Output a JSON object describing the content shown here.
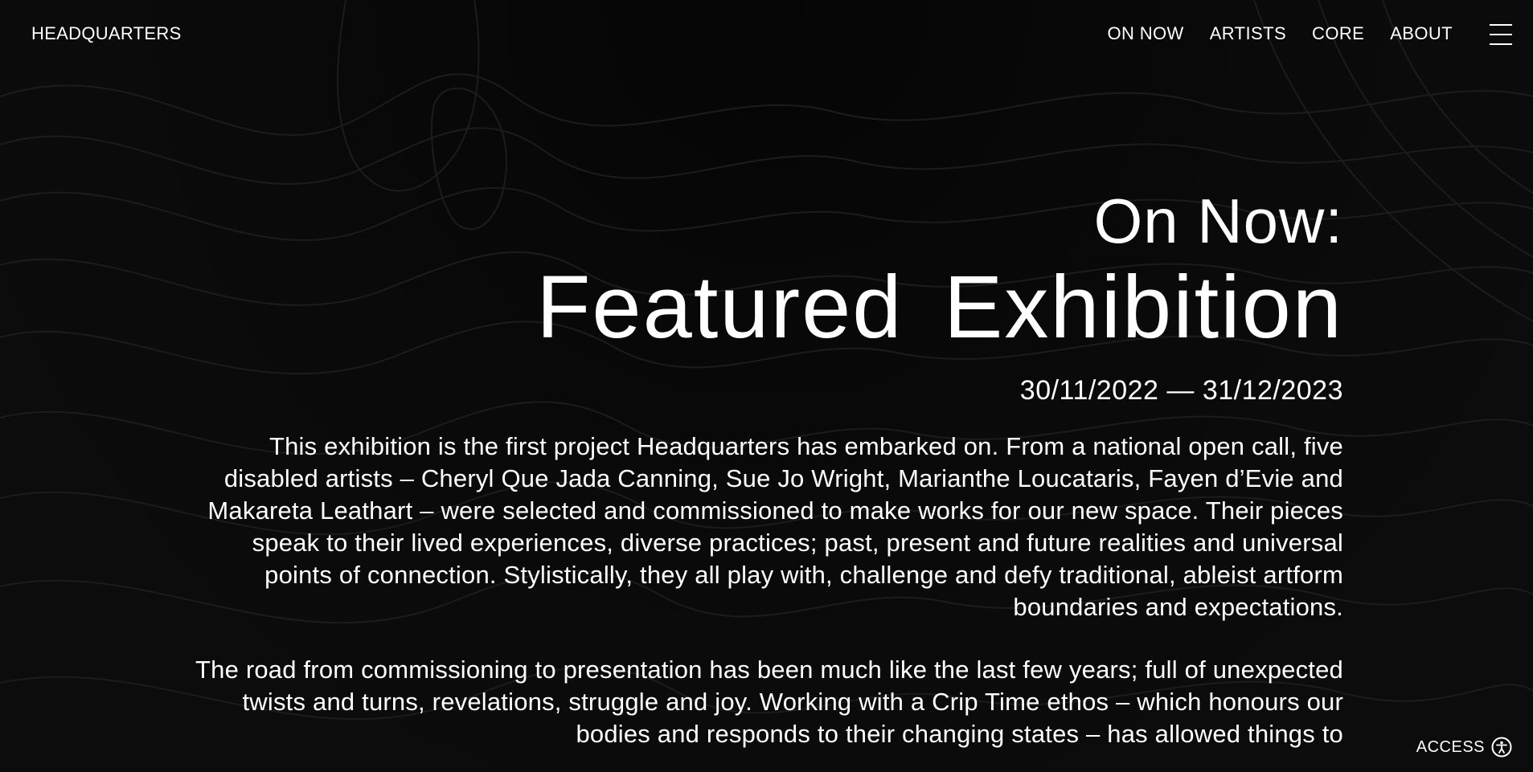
{
  "header": {
    "logo": "HEADQUARTERS",
    "nav": [
      {
        "label": "ON NOW"
      },
      {
        "label": "ARTISTS"
      },
      {
        "label": "CORE"
      },
      {
        "label": "ABOUT"
      }
    ],
    "menu_icon": "hamburger-menu-icon"
  },
  "hero": {
    "eyebrow": "On Now:",
    "title": "Featured Exhibition",
    "dates": "30/11/2022 — 31/12/2023",
    "paragraphs": [
      "This exhibition is the first project Headquarters has embarked on. From a national open call, five disabled artists – Cheryl Que Jada Canning, Sue Jo Wright, Marianthe Loucataris, Fayen d’Evie and Makareta Leathart – were selected and commissioned to make works for our new space. Their pieces speak to their lived experiences, diverse practices; past, present and future realities and universal points of connection. Stylistically, they all play with, challenge and defy traditional, ableist artform boundaries and expectations.",
      "The road from commissioning to presentation has been much like the last few years; full of unexpected twists and turns, revelations, struggle and joy. Working with a Crip Time ethos – which honours our bodies and responds to their changing states – has allowed things to"
    ]
  },
  "access": {
    "label": "ACCESS",
    "icon": "accessibility-icon"
  },
  "colors": {
    "background": "#0a0a0a",
    "text": "#ffffff",
    "contour": "#1c1c1c"
  }
}
